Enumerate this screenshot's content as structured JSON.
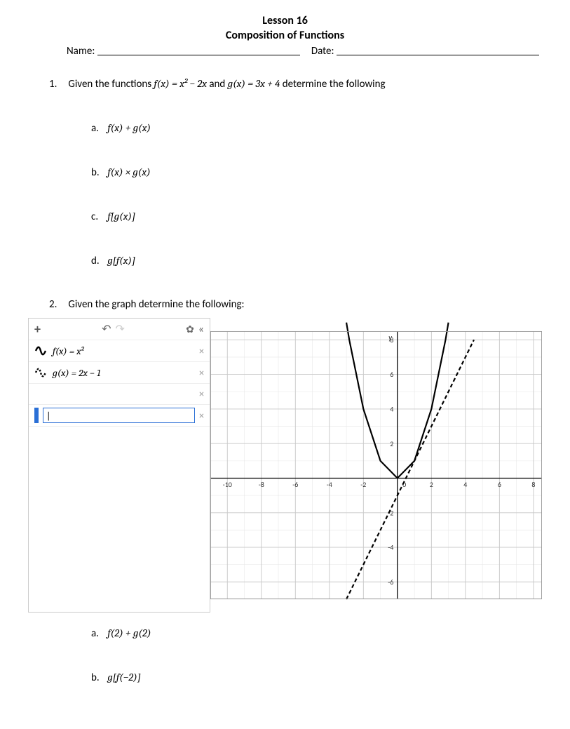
{
  "header": {
    "lesson": "Lesson 16",
    "topic": "Composition of Functions",
    "name_label": "Name:",
    "date_label": "Date:"
  },
  "q1": {
    "number": "1.",
    "lead_in": "Given the functions ",
    "f_def": "f(x) = x² − 2x",
    "and": " and ",
    "g_def": "g(x) = 3x + 4",
    "tail": " determine the following",
    "a_label": "a.",
    "a_expr": "f(x) + g(x)",
    "b_label": "b.",
    "b_expr": "f(x) × g(x)",
    "c_label": "c.",
    "c_expr": "f[g(x)]",
    "d_label": "d.",
    "d_expr": "g[f(x)]"
  },
  "q2": {
    "number": "2.",
    "text": "Given the graph determine the following:",
    "a_label": "a.",
    "a_expr": "f(2) + g(2)",
    "b_label": "b.",
    "b_expr": "g[f(−2)]"
  },
  "eq_panel": {
    "add": "+",
    "undo": "↶",
    "redo": "↷",
    "gear": "✿",
    "collapse": "«",
    "row1": "f(x) = x²",
    "row2": "g(x) = 2x − 1",
    "close": "×",
    "input_value": "|"
  },
  "chart_data": {
    "type": "line",
    "title": "",
    "xlabel": "",
    "ylabel": "y",
    "xlim": [
      -11,
      8.5
    ],
    "ylim": [
      -7,
      8.5
    ],
    "x_ticks": [
      -10,
      -8,
      -6,
      -4,
      -2,
      0,
      2,
      4,
      6,
      8
    ],
    "y_ticks": [
      -6,
      -4,
      -2,
      0,
      2,
      4,
      6,
      8
    ],
    "grid_minor": 1,
    "series": [
      {
        "name": "f(x)=x^2",
        "style": "solid",
        "points": [
          [
            -3,
            9
          ],
          [
            -2.83,
            8
          ],
          [
            -2,
            4
          ],
          [
            -1,
            1
          ],
          [
            0,
            0
          ],
          [
            1,
            1
          ],
          [
            2,
            4
          ],
          [
            2.83,
            8
          ],
          [
            3,
            9
          ]
        ]
      },
      {
        "name": "g(x)=2x-1",
        "style": "dashed",
        "points": [
          [
            -3,
            -7
          ],
          [
            -2,
            -5
          ],
          [
            -1,
            -3
          ],
          [
            0,
            -1
          ],
          [
            1,
            1
          ],
          [
            2,
            3
          ],
          [
            3,
            5
          ],
          [
            4,
            7
          ],
          [
            4.5,
            8
          ]
        ]
      }
    ]
  }
}
